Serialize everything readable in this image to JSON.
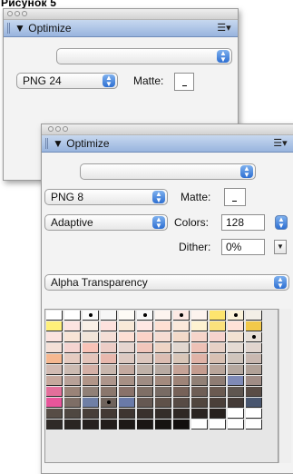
{
  "figure_label": "Рисунок 5",
  "panel1": {
    "tab_title": "Optimize",
    "settings_value": "",
    "format_value": "PNG 24",
    "matte_label": "Matte:"
  },
  "panel2": {
    "tab_title": "Optimize",
    "settings_value": "",
    "format_value": "PNG 8",
    "matte_label": "Matte:",
    "palette_value": "Adaptive",
    "colors_label": "Colors:",
    "colors_value": "128",
    "dither_label": "Dither:",
    "dither_value": "0%",
    "transparency_value": "Alpha Transparency"
  },
  "icons": {
    "triangle": "▼",
    "options": "≡",
    "updown": "▲\n▼"
  },
  "swatch_colors": [
    [
      "#ffffff",
      "#ffffff",
      "#fbfbfb",
      "#f7f7f7",
      "#fdfbf6",
      "#f8f8f8",
      "#fcf4ef",
      "#fde9e4",
      "#fcf3ee",
      "#fde56e",
      "#fbf2d9",
      "#f3efe7"
    ],
    [
      "#fff07a",
      "#fce4e1",
      "#f9f0e7",
      "#fde1dd",
      "#f8e9d8",
      "#ffe8e4",
      "#fee0d3",
      "#fbe9db",
      "#fdf2d1",
      "#fbe17c",
      "#ffe2d7",
      "#f3c94a"
    ],
    [
      "#fbe3df",
      "#f8e4d6",
      "#f1e5d9",
      "#f4ded6",
      "#fddfd4",
      "#fbd3c8",
      "#f6dcd2",
      "#f3dac9",
      "#f6d5ca",
      "#f6d3cd",
      "#f2e2d2",
      "#e8e0d8"
    ],
    [
      "#f4e0d7",
      "#f5d4d0",
      "#f8c3b7",
      "#eccdc6",
      "#e6d5cf",
      "#f1c6bb",
      "#eed4c5",
      "#e2d7cf",
      "#edc1b6",
      "#e7d0c5",
      "#e4dad2",
      "#e1d5ce"
    ],
    [
      "#f6b890",
      "#e5cbc0",
      "#e4c4ba",
      "#e8b8ad",
      "#ddc9c1",
      "#dcc7be",
      "#dcbdb2",
      "#d9c6b8",
      "#e0b3a7",
      "#d8c0b2",
      "#cfc4bb",
      "#c9b8b0"
    ],
    [
      "#d2bbb3",
      "#ccbbb2",
      "#d4b0a6",
      "#c8b6ad",
      "#c3a99f",
      "#bfb1a8",
      "#b8aaa2",
      "#c5a397",
      "#c49c8f",
      "#b9a59a",
      "#b5a89f",
      "#b1a197"
    ],
    [
      "#c6a89d",
      "#b8a198",
      "#b19588",
      "#ad958b",
      "#a79085",
      "#9f8c83",
      "#a38a7e",
      "#9e8478",
      "#918076",
      "#8e7c73",
      "#7f8ab6",
      "#a18d86"
    ],
    [
      "#e36f9b",
      "#9a8378",
      "#908077",
      "#8a776d",
      "#89726a",
      "#7f6f66",
      "#786b64",
      "#766259",
      "#6e5e56",
      "#6a5a51",
      "#5f5650",
      "#5a4d46"
    ],
    [
      "#e7559a",
      "#7e6e66",
      "#6f7fa5",
      "#6f635c",
      "#6a7aa8",
      "#655852",
      "#5f5149",
      "#574b45",
      "#51463f",
      "#4a3f39",
      "#433a36",
      "#49566f"
    ],
    [
      "#574d46",
      "#4f4741",
      "#473e39",
      "#433934",
      "#3e3531",
      "#39312d",
      "#342d29",
      "#2f2824",
      "#2a2421",
      "#26201d",
      "#ffffff",
      "#ffffff"
    ],
    [
      "#2f2a27",
      "#2a2522",
      "#26211f",
      "#221d1b",
      "#1d1917",
      "#1a1614",
      "#161311",
      "#120f0e",
      "#ffffff",
      "#ffffff",
      "#ffffff",
      "#ffffff"
    ]
  ],
  "swatch_dots": [
    [
      0,
      2
    ],
    [
      0,
      5
    ],
    [
      0,
      7
    ],
    [
      0,
      10
    ],
    [
      2,
      11
    ],
    [
      8,
      3
    ]
  ]
}
